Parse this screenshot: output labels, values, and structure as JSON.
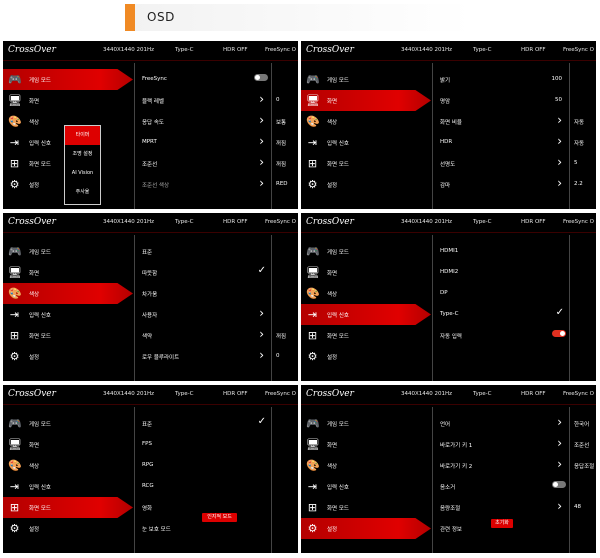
{
  "header": {
    "title": "OSD",
    "accent": "#f08a24"
  },
  "topbar": {
    "logo": "CrossOver",
    "resolution": "3440X1440 201Hz",
    "input": "Type-C",
    "hdr": "HDR OFF",
    "freesync": "FreeSync O"
  },
  "sidebar": [
    "게임 모드",
    "화면",
    "색상",
    "입력 신호",
    "화면 모드",
    "설정"
  ],
  "sidebar_icons": [
    "gamepad-icon",
    "monitor-icon",
    "palette-icon",
    "input-icon",
    "grid-icon",
    "gear-icon"
  ],
  "panels": [
    {
      "selected": 0,
      "items": [
        {
          "label": "FreeSync",
          "toggle": "off"
        },
        {
          "label": "블랙 레벨",
          "chev": true,
          "right": "0"
        },
        {
          "label": "응답 속도",
          "chev": true,
          "right": "보통"
        },
        {
          "label": "MPRT",
          "chev": true,
          "right": "꺼짐"
        },
        {
          "label": "조준선",
          "chev": true,
          "right": "꺼짐"
        },
        {
          "label": "조준선 색상",
          "dim": true,
          "chev": true,
          "right": "RED"
        }
      ],
      "popup": [
        "타이머",
        "조명 설정",
        "AI Vision",
        "주사율"
      ],
      "popup_selected": 0
    },
    {
      "selected": 1,
      "items": [
        {
          "label": "밝기",
          "value": "100"
        },
        {
          "label": "명암",
          "value": "50"
        },
        {
          "label": "화면 비율",
          "chev": true,
          "right": "자동"
        },
        {
          "label": "HDR",
          "chev": true,
          "right": "자동"
        },
        {
          "label": "선명도",
          "chev": true,
          "right": "5"
        },
        {
          "label": "감마",
          "chev": true,
          "right": "2.2"
        }
      ]
    },
    {
      "selected": 2,
      "items": [
        {
          "label": "표준"
        },
        {
          "label": "따뜻함",
          "check": true
        },
        {
          "label": "차가움"
        },
        {
          "label": "사용자",
          "chev": true
        },
        {
          "label": "색약",
          "chev": true,
          "right": "꺼짐"
        },
        {
          "label": "로우 블루라이트",
          "chev": true,
          "right": "0"
        }
      ]
    },
    {
      "selected": 3,
      "items": [
        {
          "label": "HDMI1"
        },
        {
          "label": "HDMI2"
        },
        {
          "label": "DP"
        },
        {
          "label": "Type-C",
          "check": true
        },
        {
          "label": "자동 입력",
          "toggle": "on"
        }
      ]
    },
    {
      "selected": 4,
      "items": [
        {
          "label": "표준",
          "check": true
        },
        {
          "label": "FPS"
        },
        {
          "label": "RPG"
        },
        {
          "label": "RCG"
        },
        {
          "label": "영화"
        },
        {
          "label": "눈 보호 모드"
        }
      ],
      "badge": "인지적 모드"
    },
    {
      "selected": 5,
      "items": [
        {
          "label": "언어",
          "chev": true,
          "right": "한국어"
        },
        {
          "label": "바로가기 키 1",
          "chev": true,
          "right": "조준선"
        },
        {
          "label": "바로가기 키 2",
          "chev": true,
          "right": "응답조절"
        },
        {
          "label": "음소거",
          "toggle": "off"
        },
        {
          "label": "음량조절",
          "chev": true,
          "right": "48"
        },
        {
          "label": "관련 정보"
        }
      ],
      "badge": "초기화"
    }
  ]
}
